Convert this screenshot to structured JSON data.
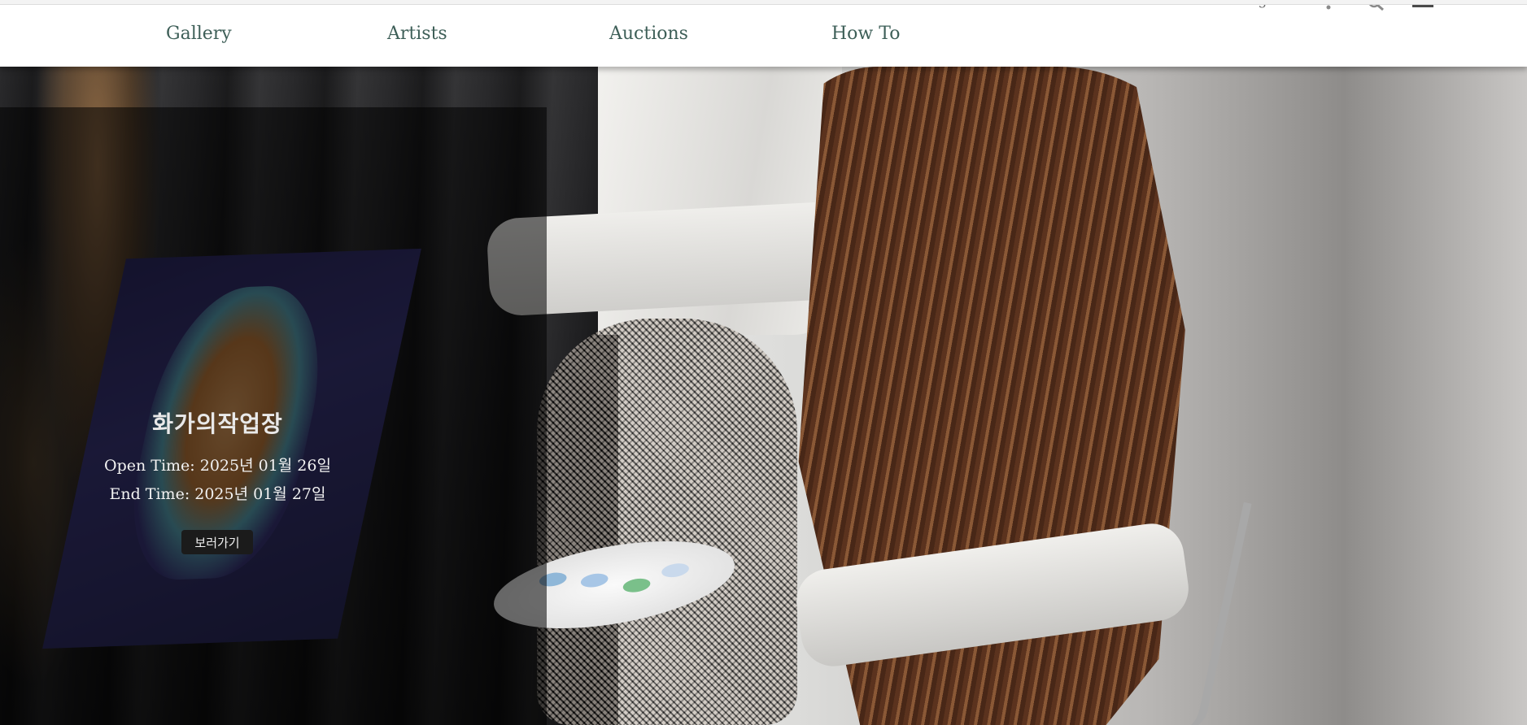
{
  "nav": {
    "items": [
      {
        "label": "Gallery"
      },
      {
        "label": "Artists"
      },
      {
        "label": "Auctions"
      },
      {
        "label": "How To"
      }
    ],
    "color": "#3e5f58"
  },
  "utility": {
    "logout_label": "Logout",
    "icons": [
      "bell-icon",
      "search-icon",
      "user-icon"
    ]
  },
  "exhibition": {
    "title": "화가의작업장",
    "open_time": "Open Time: 2025년 01월 26일",
    "end_time": "End Time: 2025년 01월 27일",
    "view_button": "보러가기"
  }
}
